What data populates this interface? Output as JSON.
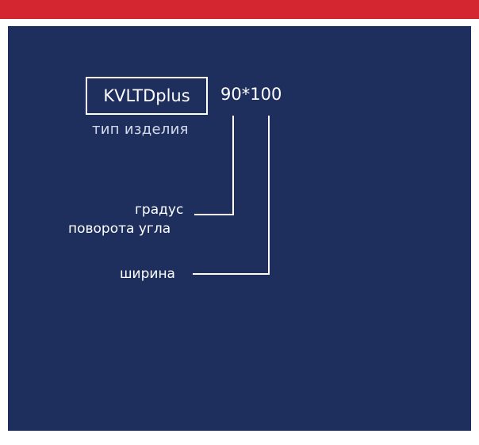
{
  "diagram": {
    "product_code": "KVLTDplus",
    "product_caption": "тип изделия",
    "size_code": "90*100",
    "labels": {
      "angle_line1": "градус",
      "angle_line2": "поворота угла",
      "width": "ширина"
    }
  },
  "colors": {
    "background": "#1e2f5e",
    "accent_stripe": "#d32630",
    "text": "#ffffff"
  }
}
